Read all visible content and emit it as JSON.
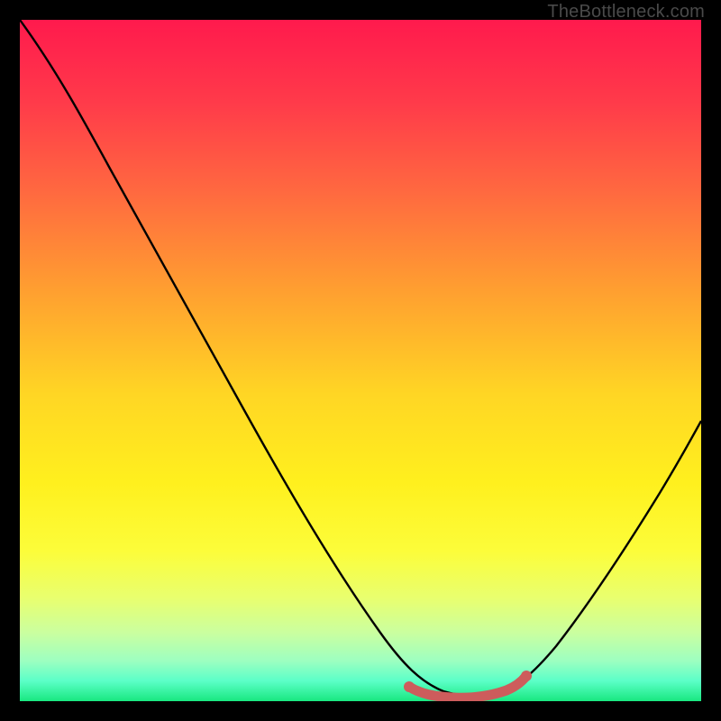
{
  "attribution": "TheBottleneck.com",
  "chart_data": {
    "type": "line",
    "title": "",
    "xlabel": "",
    "ylabel": "",
    "xlim": [
      0,
      100
    ],
    "ylim": [
      0,
      100
    ],
    "series": [
      {
        "name": "bottleneck-curve",
        "x": [
          0,
          5,
          10,
          15,
          20,
          25,
          30,
          35,
          40,
          45,
          50,
          55,
          58,
          60,
          63,
          66,
          69,
          72,
          74,
          78,
          82,
          86,
          90,
          94,
          98,
          100
        ],
        "values": [
          100,
          94,
          87,
          79,
          71,
          63,
          55,
          47,
          40,
          32,
          24,
          16,
          10,
          6,
          3,
          1,
          0,
          0,
          1,
          4,
          10,
          18,
          27,
          36,
          44,
          48
        ]
      },
      {
        "name": "optimal-range-marker",
        "x": [
          58,
          63,
          68,
          72,
          74
        ],
        "values": [
          2,
          1,
          0.5,
          1,
          2
        ]
      }
    ],
    "background_gradient_stops": [
      {
        "pos": 0,
        "color": "#ff1a4d"
      },
      {
        "pos": 12,
        "color": "#ff3a4a"
      },
      {
        "pos": 25,
        "color": "#ff6840"
      },
      {
        "pos": 40,
        "color": "#ffa030"
      },
      {
        "pos": 55,
        "color": "#ffd624"
      },
      {
        "pos": 68,
        "color": "#fff01e"
      },
      {
        "pos": 78,
        "color": "#fcfd3a"
      },
      {
        "pos": 85,
        "color": "#e8ff70"
      },
      {
        "pos": 90,
        "color": "#caffa0"
      },
      {
        "pos": 94,
        "color": "#9effc0"
      },
      {
        "pos": 97,
        "color": "#5cffc8"
      },
      {
        "pos": 100,
        "color": "#18e880"
      }
    ],
    "marker_color": "#cd5c5c"
  }
}
